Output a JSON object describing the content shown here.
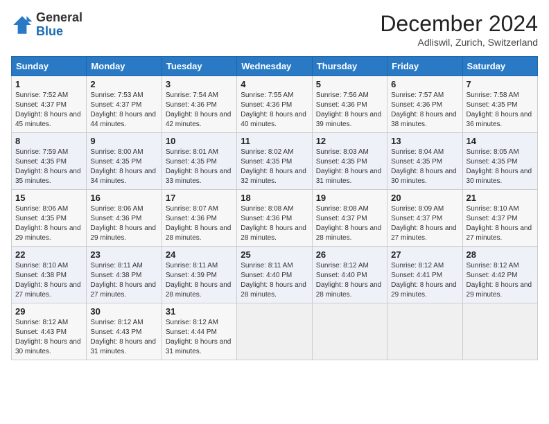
{
  "header": {
    "logo_general": "General",
    "logo_blue": "Blue",
    "month_title": "December 2024",
    "location": "Adliswil, Zurich, Switzerland"
  },
  "days_of_week": [
    "Sunday",
    "Monday",
    "Tuesday",
    "Wednesday",
    "Thursday",
    "Friday",
    "Saturday"
  ],
  "weeks": [
    [
      {
        "day": "1",
        "sunrise": "7:52 AM",
        "sunset": "4:37 PM",
        "daylight": "8 hours and 45 minutes."
      },
      {
        "day": "2",
        "sunrise": "7:53 AM",
        "sunset": "4:37 PM",
        "daylight": "8 hours and 44 minutes."
      },
      {
        "day": "3",
        "sunrise": "7:54 AM",
        "sunset": "4:36 PM",
        "daylight": "8 hours and 42 minutes."
      },
      {
        "day": "4",
        "sunrise": "7:55 AM",
        "sunset": "4:36 PM",
        "daylight": "8 hours and 40 minutes."
      },
      {
        "day": "5",
        "sunrise": "7:56 AM",
        "sunset": "4:36 PM",
        "daylight": "8 hours and 39 minutes."
      },
      {
        "day": "6",
        "sunrise": "7:57 AM",
        "sunset": "4:36 PM",
        "daylight": "8 hours and 38 minutes."
      },
      {
        "day": "7",
        "sunrise": "7:58 AM",
        "sunset": "4:35 PM",
        "daylight": "8 hours and 36 minutes."
      }
    ],
    [
      {
        "day": "8",
        "sunrise": "7:59 AM",
        "sunset": "4:35 PM",
        "daylight": "8 hours and 35 minutes."
      },
      {
        "day": "9",
        "sunrise": "8:00 AM",
        "sunset": "4:35 PM",
        "daylight": "8 hours and 34 minutes."
      },
      {
        "day": "10",
        "sunrise": "8:01 AM",
        "sunset": "4:35 PM",
        "daylight": "8 hours and 33 minutes."
      },
      {
        "day": "11",
        "sunrise": "8:02 AM",
        "sunset": "4:35 PM",
        "daylight": "8 hours and 32 minutes."
      },
      {
        "day": "12",
        "sunrise": "8:03 AM",
        "sunset": "4:35 PM",
        "daylight": "8 hours and 31 minutes."
      },
      {
        "day": "13",
        "sunrise": "8:04 AM",
        "sunset": "4:35 PM",
        "daylight": "8 hours and 30 minutes."
      },
      {
        "day": "14",
        "sunrise": "8:05 AM",
        "sunset": "4:35 PM",
        "daylight": "8 hours and 30 minutes."
      }
    ],
    [
      {
        "day": "15",
        "sunrise": "8:06 AM",
        "sunset": "4:35 PM",
        "daylight": "8 hours and 29 minutes."
      },
      {
        "day": "16",
        "sunrise": "8:06 AM",
        "sunset": "4:36 PM",
        "daylight": "8 hours and 29 minutes."
      },
      {
        "day": "17",
        "sunrise": "8:07 AM",
        "sunset": "4:36 PM",
        "daylight": "8 hours and 28 minutes."
      },
      {
        "day": "18",
        "sunrise": "8:08 AM",
        "sunset": "4:36 PM",
        "daylight": "8 hours and 28 minutes."
      },
      {
        "day": "19",
        "sunrise": "8:08 AM",
        "sunset": "4:37 PM",
        "daylight": "8 hours and 28 minutes."
      },
      {
        "day": "20",
        "sunrise": "8:09 AM",
        "sunset": "4:37 PM",
        "daylight": "8 hours and 27 minutes."
      },
      {
        "day": "21",
        "sunrise": "8:10 AM",
        "sunset": "4:37 PM",
        "daylight": "8 hours and 27 minutes."
      }
    ],
    [
      {
        "day": "22",
        "sunrise": "8:10 AM",
        "sunset": "4:38 PM",
        "daylight": "8 hours and 27 minutes."
      },
      {
        "day": "23",
        "sunrise": "8:11 AM",
        "sunset": "4:38 PM",
        "daylight": "8 hours and 27 minutes."
      },
      {
        "day": "24",
        "sunrise": "8:11 AM",
        "sunset": "4:39 PM",
        "daylight": "8 hours and 28 minutes."
      },
      {
        "day": "25",
        "sunrise": "8:11 AM",
        "sunset": "4:40 PM",
        "daylight": "8 hours and 28 minutes."
      },
      {
        "day": "26",
        "sunrise": "8:12 AM",
        "sunset": "4:40 PM",
        "daylight": "8 hours and 28 minutes."
      },
      {
        "day": "27",
        "sunrise": "8:12 AM",
        "sunset": "4:41 PM",
        "daylight": "8 hours and 29 minutes."
      },
      {
        "day": "28",
        "sunrise": "8:12 AM",
        "sunset": "4:42 PM",
        "daylight": "8 hours and 29 minutes."
      }
    ],
    [
      {
        "day": "29",
        "sunrise": "8:12 AM",
        "sunset": "4:43 PM",
        "daylight": "8 hours and 30 minutes."
      },
      {
        "day": "30",
        "sunrise": "8:12 AM",
        "sunset": "4:43 PM",
        "daylight": "8 hours and 31 minutes."
      },
      {
        "day": "31",
        "sunrise": "8:12 AM",
        "sunset": "4:44 PM",
        "daylight": "8 hours and 31 minutes."
      },
      null,
      null,
      null,
      null
    ]
  ]
}
